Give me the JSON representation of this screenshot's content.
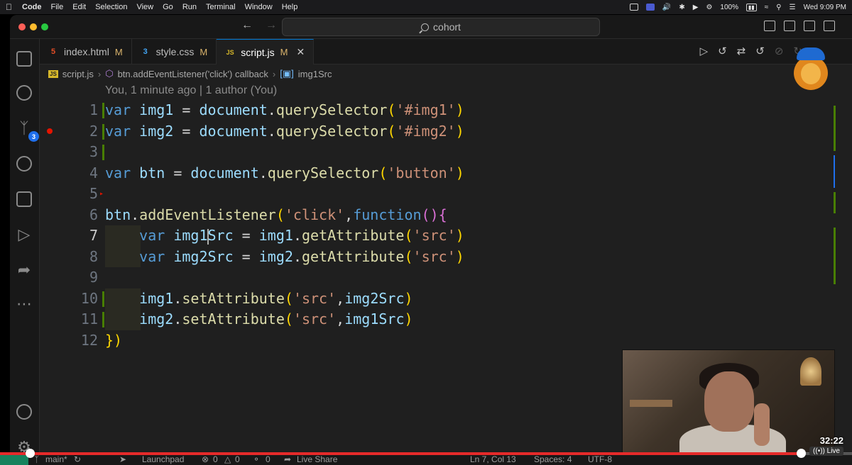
{
  "menubar": {
    "app_name": "Code",
    "items": [
      "File",
      "Edit",
      "Selection",
      "View",
      "Go",
      "Run",
      "Terminal",
      "Window",
      "Help"
    ],
    "battery": "100%",
    "clock": "Wed 9:09 PM"
  },
  "titlebar": {
    "search_text": "cohort"
  },
  "activitybar": {
    "scm_badge": "3"
  },
  "tabs": [
    {
      "label": "index.html",
      "icon": "html5-icon",
      "icon_glyph": "5",
      "icon_color": "#e44d26",
      "status": "M",
      "active": false
    },
    {
      "label": "style.css",
      "icon": "css3-icon",
      "icon_glyph": "3",
      "icon_color": "#42a5f5",
      "status": "M",
      "active": false
    },
    {
      "label": "script.js",
      "icon": "js-icon",
      "icon_glyph": "JS",
      "icon_color": "#d7b82a",
      "status": "M",
      "active": true
    }
  ],
  "breadcrumb": {
    "file": "script.js",
    "scope": "btn.addEventListener('click') callback",
    "symbol": "img1Src"
  },
  "blame": "You, 1 minute ago | 1 author (You)",
  "code": {
    "current_line": 7,
    "lines": [
      {
        "n": "1",
        "text": "var img1 = document.querySelector('#img1')"
      },
      {
        "n": "2",
        "text": "var img2 = document.querySelector('#img2')"
      },
      {
        "n": "3",
        "text": ""
      },
      {
        "n": "4",
        "text": "var btn = document.querySelector('button')"
      },
      {
        "n": "5",
        "text": ""
      },
      {
        "n": "6",
        "text": "btn.addEventListener('click',function(){"
      },
      {
        "n": "7",
        "text": "    var img1Src = img1.getAttribute('src')"
      },
      {
        "n": "8",
        "text": "    var img2Src = img2.getAttribute('src')"
      },
      {
        "n": "9",
        "text": ""
      },
      {
        "n": "10",
        "text": "    img1.setAttribute('src',img2Src)"
      },
      {
        "n": "11",
        "text": "    img2.setAttribute('src',img1Src)"
      },
      {
        "n": "12",
        "text": "})"
      }
    ]
  },
  "statusbar": {
    "branch": "main*",
    "launchpad": "Launchpad",
    "errors": "0",
    "warnings": "0",
    "ports": "0",
    "live_share": "Live Share",
    "cursor_pos": "Ln 7, Col 13",
    "spaces": "Spaces: 4",
    "encoding": "UTF-8"
  },
  "video": {
    "time": "32:22",
    "live": "Live",
    "progress": 0.94
  },
  "colors": {
    "accent": "#0078d4",
    "modified": "#487e02",
    "breakpoint": "#e51400",
    "progress": "#e52a2a"
  }
}
